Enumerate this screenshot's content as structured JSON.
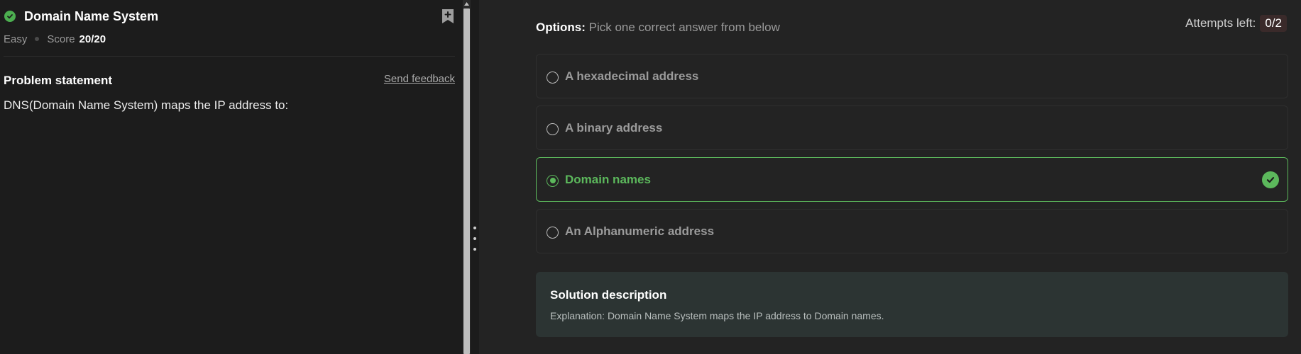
{
  "problem": {
    "title": "Domain Name System",
    "difficulty": "Easy",
    "score_label": "Score",
    "score_value": "20/20",
    "statement_heading": "Problem statement",
    "feedback_link": "Send feedback",
    "statement_text": "DNS(Domain Name System) maps the IP address to:"
  },
  "quiz": {
    "options_label_bold": "Options:",
    "options_label_rest": "Pick one correct answer from below",
    "attempts_label": "Attempts left:",
    "attempts_value": "0/2",
    "options": [
      {
        "label": "A hexadecimal address",
        "selected": false
      },
      {
        "label": "A binary address",
        "selected": false
      },
      {
        "label": "Domain names",
        "selected": true,
        "correct": true
      },
      {
        "label": "An Alphanumeric address",
        "selected": false
      }
    ]
  },
  "solution": {
    "title": "Solution description",
    "text": "Explanation: Domain Name System maps the IP address to Domain names."
  },
  "colors": {
    "accent_green": "#5cb85c",
    "background": "#1c1c1c",
    "panel": "#232323",
    "solution_bg": "#2c3433"
  },
  "icons": {
    "status": "check-circle-icon",
    "bookmark": "bookmark-plus-icon",
    "correct": "check-circle-icon"
  }
}
